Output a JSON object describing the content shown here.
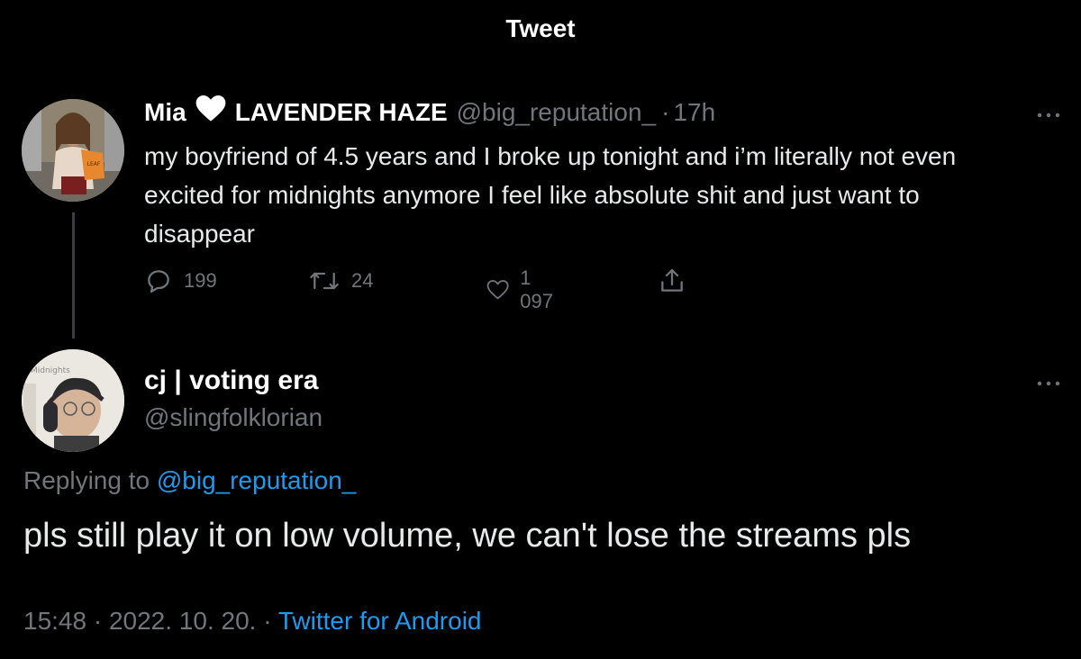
{
  "header": {
    "title": "Tweet"
  },
  "parent_tweet": {
    "display_name_first": "Mia",
    "heart_icon": "white-heart-icon",
    "display_name_second": "LAVENDER HAZE",
    "handle": "@big_reputation_",
    "separator": "·",
    "time": "17h",
    "text": "my boyfriend of 4.5 years and I broke up tonight and i’m literally not even excited for midnights anymore I feel like absolute shit and just want to disappear",
    "replies": "199",
    "retweets": "24",
    "likes": "1 097"
  },
  "reply_tweet": {
    "avatar_caption": "Midnights",
    "display_name": "cj | voting era",
    "handle": "@slingfolklorian",
    "replying_prefix": "Replying to",
    "replying_handle": "@big_reputation_",
    "text": "pls still play it on low volume, we can't lose the streams pls",
    "time": "15:48",
    "dot1": "·",
    "date": "2022. 10. 20.",
    "dot2": "·",
    "source": "Twitter for Android"
  },
  "colors": {
    "background": "#000000",
    "text": "#e7e9ea",
    "muted": "#71767b",
    "link": "#1d9bf0"
  }
}
